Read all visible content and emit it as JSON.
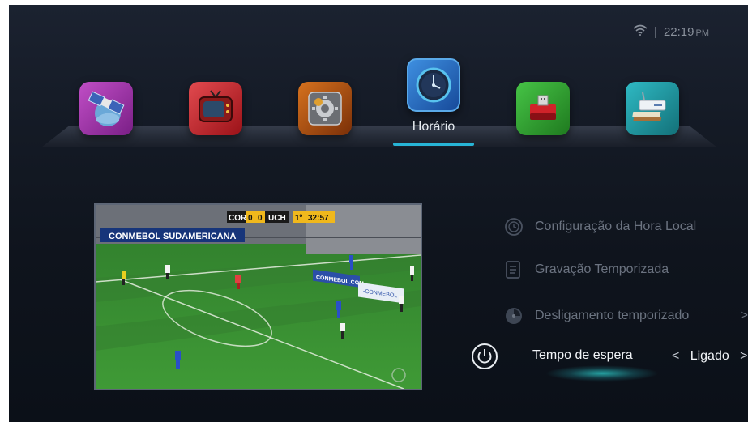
{
  "status": {
    "wifi_icon": "wifi-icon",
    "separator": "|",
    "time": "22:19",
    "ampm": "PM"
  },
  "apps": [
    {
      "name": "satellite-app",
      "icon": "satellite-icon",
      "color": "#9b2fa0"
    },
    {
      "name": "tv-app",
      "icon": "tv-icon",
      "color": "#c8222d"
    },
    {
      "name": "settings-app",
      "icon": "gear-box-icon",
      "color": "#b04a12"
    },
    {
      "name": "clock-app",
      "icon": "clock-icon",
      "color": "#2f7fd0",
      "selected": true,
      "label": "Horário"
    },
    {
      "name": "usb-app",
      "icon": "usb-drive-icon",
      "color": "#2aa02a"
    },
    {
      "name": "network-app",
      "icon": "router-icon",
      "color": "#1f9aa6"
    }
  ],
  "preview": {
    "banner": "CONMEBOL SUDAMERICANA",
    "score_home": "COR",
    "score_home_val": "0",
    "score_away_val": "0",
    "score_away": "UCH",
    "period": "1º",
    "clock": "32:57",
    "board1": "CONMEBOL.COM",
    "board2": "-CONMEBOL-"
  },
  "menu": {
    "items": [
      {
        "label": "Configuração da Hora Local",
        "icon": "clock-outline-icon"
      },
      {
        "label": "Gravação Temporizada",
        "icon": "document-icon"
      },
      {
        "label": "Desligamento temporizado",
        "icon": "timer-icon",
        "arrow": ">"
      }
    ],
    "selected": {
      "label": "Tempo de espera",
      "icon": "power-icon",
      "left_arrow": "<",
      "value": "Ligado",
      "right_arrow": ">"
    }
  },
  "colors": {
    "accent": "#27b4d6",
    "background": "#141a25",
    "dim_text": "#6b7380"
  }
}
